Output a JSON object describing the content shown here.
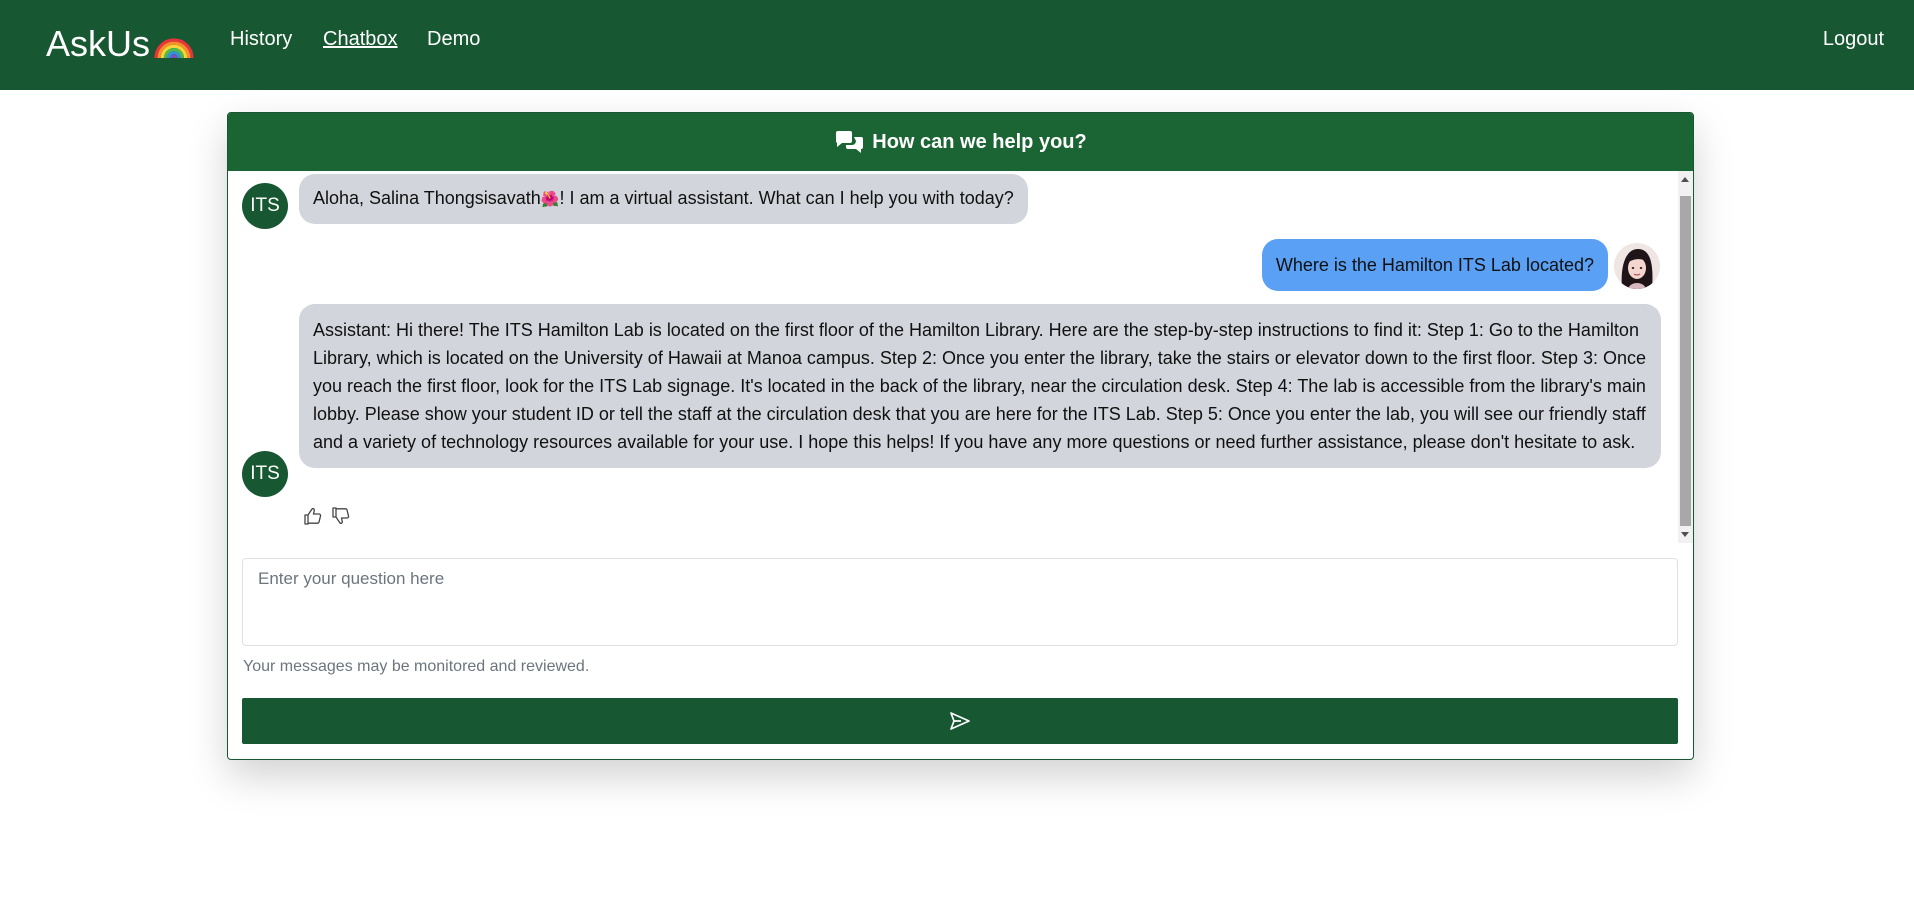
{
  "navbar": {
    "brand": "AskUs",
    "brand_icon": "rainbow-icon",
    "links": [
      {
        "label": "History",
        "active": false
      },
      {
        "label": "Chatbox",
        "active": true
      },
      {
        "label": "Demo",
        "active": false
      }
    ],
    "logout_label": "Logout",
    "colors": {
      "background": "#175731",
      "text": "#ffffff"
    }
  },
  "chat": {
    "header_title": "How can we help you?",
    "header_icon": "chat-bubbles-icon",
    "bot_avatar_label": "ITS",
    "messages": [
      {
        "role": "assistant",
        "text_before_emoji": "Aloha, Salina Thongsisavath",
        "emoji": "🌺",
        "text_after_emoji": "! I am a virtual assistant. What can I help you with today?"
      },
      {
        "role": "user",
        "text": "Where is the Hamilton ITS Lab located?"
      },
      {
        "role": "assistant",
        "text": "Assistant: Hi there! The ITS Hamilton Lab is located on the first floor of the Hamilton Library. Here are the step-by-step instructions to find it: Step 1: Go to the Hamilton Library, which is located on the University of Hawaii at Manoa campus. Step 2: Once you enter the library, take the stairs or elevator down to the first floor. Step 3: Once you reach the first floor, look for the ITS Lab signage. It's located in the back of the library, near the circulation desk. Step 4: The lab is accessible from the library's main lobby. Please show your student ID or tell the staff at the circulation desk that you are here for the ITS Lab. Step 5: Once you enter the lab, you will see our friendly staff and a variety of technology resources available for your use. I hope this helps! If you have any more questions or need further assistance, please don't hesitate to ask."
      }
    ],
    "feedback_icons": [
      "thumbs-up-icon",
      "thumbs-down-icon"
    ],
    "input_placeholder": "Enter your question here",
    "input_value": "",
    "disclaimer": "Your messages may be monitored and reviewed.",
    "send_icon": "send-icon",
    "colors": {
      "header": "#1b6535",
      "bot_bubble": "#d2d5db",
      "user_bubble": "#5aa0f5",
      "send_button": "#175731"
    }
  }
}
